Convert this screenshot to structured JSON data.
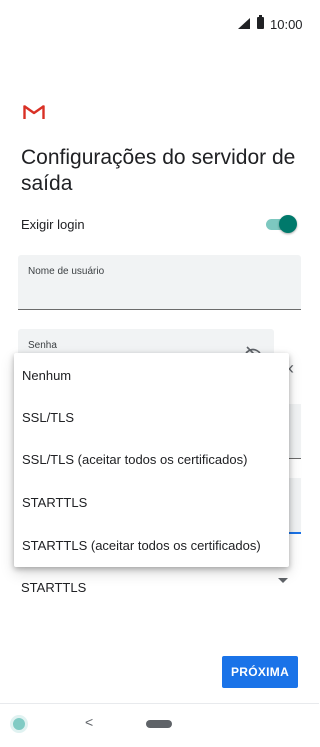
{
  "status_bar": {
    "time": "10:00",
    "icons": [
      "signal-icon",
      "battery-icon"
    ]
  },
  "app": {
    "logo": "gmail-logo"
  },
  "page": {
    "title": "Configurações do servidor de saída"
  },
  "login": {
    "label": "Exigir login",
    "enabled": true,
    "accent_color": "#00796b"
  },
  "fields": {
    "username": {
      "label": "Nome de usuário",
      "value": ""
    },
    "password": {
      "label": "Senha",
      "value": ""
    }
  },
  "security": {
    "selected": "STARTTLS"
  },
  "menu": {
    "items": [
      "Nenhum",
      "SSL/TLS",
      "SSL/TLS (aceitar todos os certificados)",
      "STARTTLS",
      "STARTTLS (aceitar todos os certificados)"
    ]
  },
  "buttons": {
    "next": "PRÓXIMA",
    "primary_color": "#1a73e8"
  },
  "nav": {
    "icons": [
      "assistant-icon",
      "back-icon",
      "home-icon"
    ]
  }
}
